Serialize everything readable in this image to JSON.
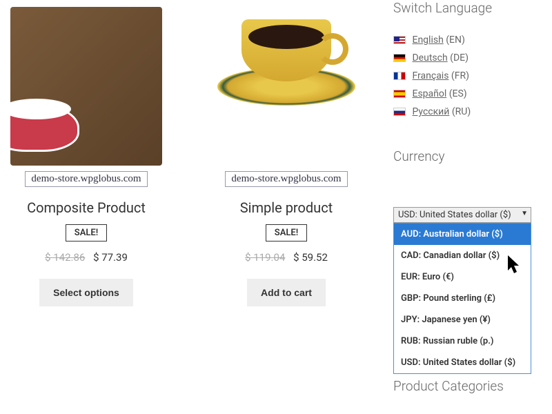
{
  "products": [
    {
      "title": "Composite Product",
      "sale": "SALE!",
      "old_price": "$ 142.86",
      "new_price": "$ 77.39",
      "button": "Select options",
      "watermark": "demo-store.wpglobus.com"
    },
    {
      "title": "Simple product",
      "sale": "SALE!",
      "old_price": "$ 119.04",
      "new_price": "$ 59.52",
      "button": "Add to cart",
      "watermark": "demo-store.wpglobus.com"
    }
  ],
  "sidebar": {
    "language_heading": "Switch Language",
    "languages": [
      {
        "label": "English",
        "code": "(EN)"
      },
      {
        "label": "Deutsch",
        "code": "(DE)"
      },
      {
        "label": "Français",
        "code": "(FR)"
      },
      {
        "label": "Español",
        "code": "(ES)"
      },
      {
        "label": "Русский",
        "code": "(RU)"
      }
    ],
    "currency_heading": "Currency",
    "currency_selected": "USD: United States dollar ($)",
    "currency_options": [
      "AUD: Australian dollar ($)",
      "CAD: Canadian dollar ($)",
      "EUR: Euro (€)",
      "GBP: Pound sterling (£)",
      "JPY: Japanese yen (¥)",
      "RUB: Russian ruble (p.)",
      "USD: United States dollar ($)"
    ],
    "categories_heading": "Product Categories"
  }
}
